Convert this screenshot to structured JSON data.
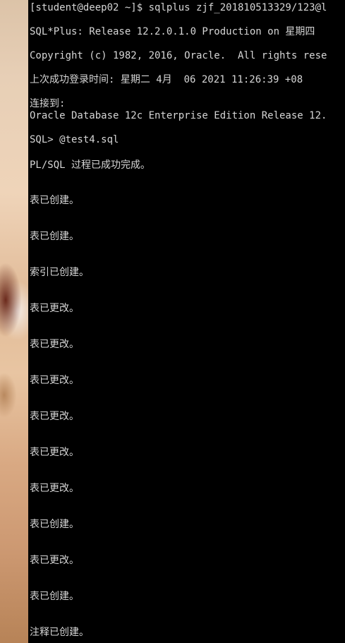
{
  "terminal": {
    "lines": [
      "[student@deep02 ~]$ sqlplus zjf_201810513329/123@l",
      "SQL*Plus: Release 12.2.0.1.0 Production on 星期四",
      "Copyright (c) 1982, 2016, Oracle.  All rights rese",
      "上次成功登录时间: 星期二 4月  06 2021 11:26:39 +08",
      "连接到:",
      "Oracle Database 12c Enterprise Edition Release 12.",
      "SQL> @test4.sql",
      "PL/SQL 过程已成功完成。",
      "表已创建。",
      "表已创建。",
      "索引已创建。",
      "表已更改。",
      "表已更改。",
      "表已更改。",
      "表已更改。",
      "表已更改。",
      "表已更改。",
      "表已创建。",
      "表已更改。",
      "表已创建。",
      "注释已创建。"
    ]
  }
}
